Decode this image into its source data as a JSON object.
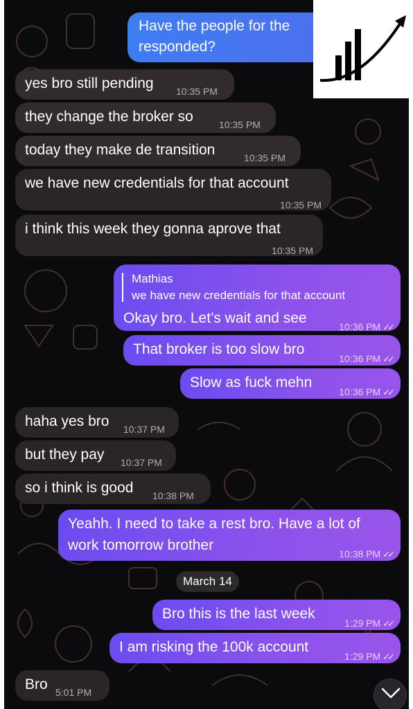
{
  "messages": [
    {
      "text": "Have the people for the",
      "text2": "responded?"
    },
    {
      "text": "yes bro still pending",
      "time": "10:35 PM"
    },
    {
      "text": "they change the broker so",
      "time": "10:35 PM"
    },
    {
      "text": "today they make de transition",
      "time": "10:35 PM"
    },
    {
      "text": "we have new credentials for that account",
      "time": "10:35 PM"
    },
    {
      "text": "i think this week they gonna aprove that",
      "time": "10:35 PM"
    },
    {
      "reply_name": "Mathias",
      "reply_text": "we have new credentials for that account",
      "text": "Okay bro. Let’s wait and see",
      "time": "10:36 PM"
    },
    {
      "text": "That broker is too slow bro",
      "time": "10:36 PM"
    },
    {
      "text": "Slow as fuck mehn",
      "time": "10:36 PM"
    },
    {
      "text": "haha yes bro",
      "time": "10:37 PM"
    },
    {
      "text": "but they pay",
      "time": "10:37 PM"
    },
    {
      "text": "so i think is good",
      "time": "10:38 PM"
    },
    {
      "text": "Yeahh. I need to take a rest bro. Have a lot of",
      "text2": "work tomorrow brother",
      "time": "10:38 PM"
    },
    {
      "text": "Bro this is the last week",
      "time": "1:29 PM"
    },
    {
      "text": "I am risking the 100k account",
      "time": "1:29 PM"
    },
    {
      "text": "Bro",
      "time": "5:01 PM"
    }
  ],
  "date_separator": "March 14",
  "icons": {
    "read_ticks": "double-check-icon",
    "scroll_down": "chevron-down-icon",
    "logo": "growth-chart-logo"
  },
  "colors": {
    "background": "#0b0b0d",
    "incoming_bubble": "#2a2628",
    "outgoing_bubble": "#8c52ec",
    "outgoing_bubble_blue": "#4f6fee"
  }
}
